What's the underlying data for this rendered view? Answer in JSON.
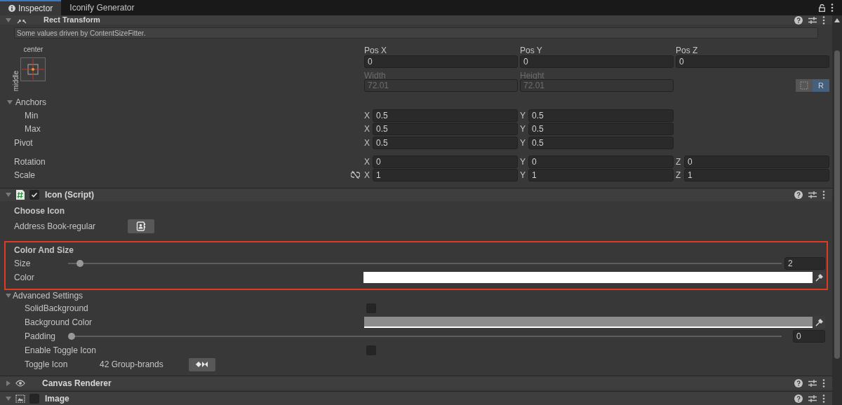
{
  "tabs": [
    {
      "label": "Inspector",
      "selected": true
    },
    {
      "label": "Iconify Generator",
      "selected": false
    }
  ],
  "rect_transform": {
    "title": "Rect Transform",
    "expanded": true,
    "notice": "Some values driven by ContentSizeFitter.",
    "anchor_preset": {
      "horizontal": "center",
      "vertical": "middle"
    },
    "position_fields": [
      {
        "label": "Pos X",
        "value": "0",
        "disabled": false
      },
      {
        "label": "Pos Y",
        "value": "0",
        "disabled": false
      },
      {
        "label": "Pos Z",
        "value": "0",
        "disabled": false
      }
    ],
    "size_fields": [
      {
        "label": "Width",
        "value": "72.01",
        "disabled": true
      },
      {
        "label": "Height",
        "value": "72.01",
        "disabled": true
      }
    ],
    "edit_buttons": [
      {
        "kind": "blueprint",
        "selected": false
      },
      {
        "kind": "raw",
        "label": "R",
        "selected": true
      }
    ],
    "anchors": {
      "label": "Anchors",
      "expanded": true,
      "rows": [
        {
          "label": "Min",
          "fields": [
            {
              "axis": "X",
              "value": "0.5"
            },
            {
              "axis": "Y",
              "value": "0.5"
            }
          ]
        },
        {
          "label": "Max",
          "fields": [
            {
              "axis": "X",
              "value": "0.5"
            },
            {
              "axis": "Y",
              "value": "0.5"
            }
          ]
        }
      ]
    },
    "rows": [
      {
        "label": "Pivot",
        "fields": [
          {
            "axis": "X",
            "value": "0.5"
          },
          {
            "axis": "Y",
            "value": "0.5"
          }
        ]
      },
      {
        "label": "Rotation",
        "fields": [
          {
            "axis": "X",
            "value": "0"
          },
          {
            "axis": "Y",
            "value": "0"
          },
          {
            "axis": "Z",
            "value": "0"
          }
        ]
      },
      {
        "label": "Scale",
        "constrained": false,
        "fields": [
          {
            "axis": "X",
            "value": "1"
          },
          {
            "axis": "Y",
            "value": "1"
          },
          {
            "axis": "Z",
            "value": "1"
          }
        ]
      }
    ]
  },
  "icon_script": {
    "title": "Icon (Script)",
    "enabled": true,
    "expanded": true,
    "choose_heading": "Choose Icon",
    "icon_label": "Address Book-regular",
    "color_and_size": {
      "heading": "Color And Size",
      "highlighted": true,
      "size": {
        "label": "Size",
        "level": 0.012,
        "value": "2"
      },
      "color_label": "Color",
      "color": "#ffffff"
    },
    "advanced": {
      "label": "Advanced Settings",
      "expanded": true,
      "items": [
        {
          "kind": "checkbox",
          "label": "SolidBackground",
          "checked": false
        },
        {
          "kind": "color",
          "label": "Background Color",
          "color": "#8c8c8c"
        },
        {
          "kind": "slider",
          "label": "Padding",
          "level": 0,
          "value": "0"
        },
        {
          "kind": "checkbox",
          "label": "Enable Toggle Icon",
          "checked": false
        },
        {
          "kind": "icon",
          "label": "Toggle Icon",
          "value": "42 Group-brands"
        }
      ]
    }
  },
  "components": [
    {
      "title": "Canvas Renderer",
      "kind": "eye",
      "expanded": false
    },
    {
      "title": "Image",
      "kind": "image",
      "expanded": true,
      "enabled": false
    }
  ]
}
